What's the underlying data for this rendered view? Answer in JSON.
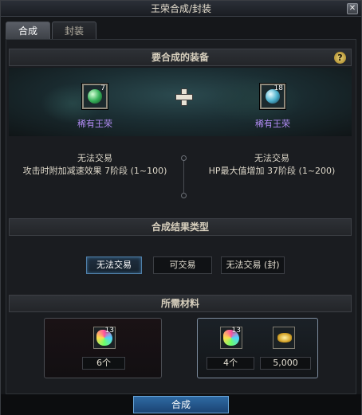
{
  "window": {
    "title": "王荣合成/封装",
    "close_glyph": "✕"
  },
  "tabs": [
    {
      "label": "合成"
    },
    {
      "label": "封装"
    }
  ],
  "section1": {
    "header": "要合成的装备",
    "help_glyph": "?",
    "left_item": {
      "name": "稀有王荣",
      "count": "7",
      "icon": "green-gem-icon"
    },
    "right_item": {
      "name": "稀有王荣",
      "count": "18",
      "icon": "blue-gem-icon"
    },
    "left_info": {
      "trade": "无法交易",
      "effect": "攻击时附加减速效果 7阶段 (1~100)"
    },
    "right_info": {
      "trade": "无法交易",
      "effect": "HP最大值增加 37阶段 (1~200)"
    }
  },
  "section2": {
    "header": "合成结果类型",
    "options": [
      {
        "label": "无法交易",
        "selected": true
      },
      {
        "label": "可交易",
        "selected": false
      },
      {
        "label": "无法交易 (封)",
        "selected": false
      }
    ]
  },
  "section3": {
    "header": "所需材料",
    "left_box": {
      "count": "13",
      "qty": "6个"
    },
    "right_box": {
      "count": "13",
      "qty": "4个",
      "gold": "5,000"
    }
  },
  "footer": {
    "button_label": "合成"
  },
  "colors": {
    "accent": "#2f6aa3",
    "item_name": "#b28cf5"
  }
}
